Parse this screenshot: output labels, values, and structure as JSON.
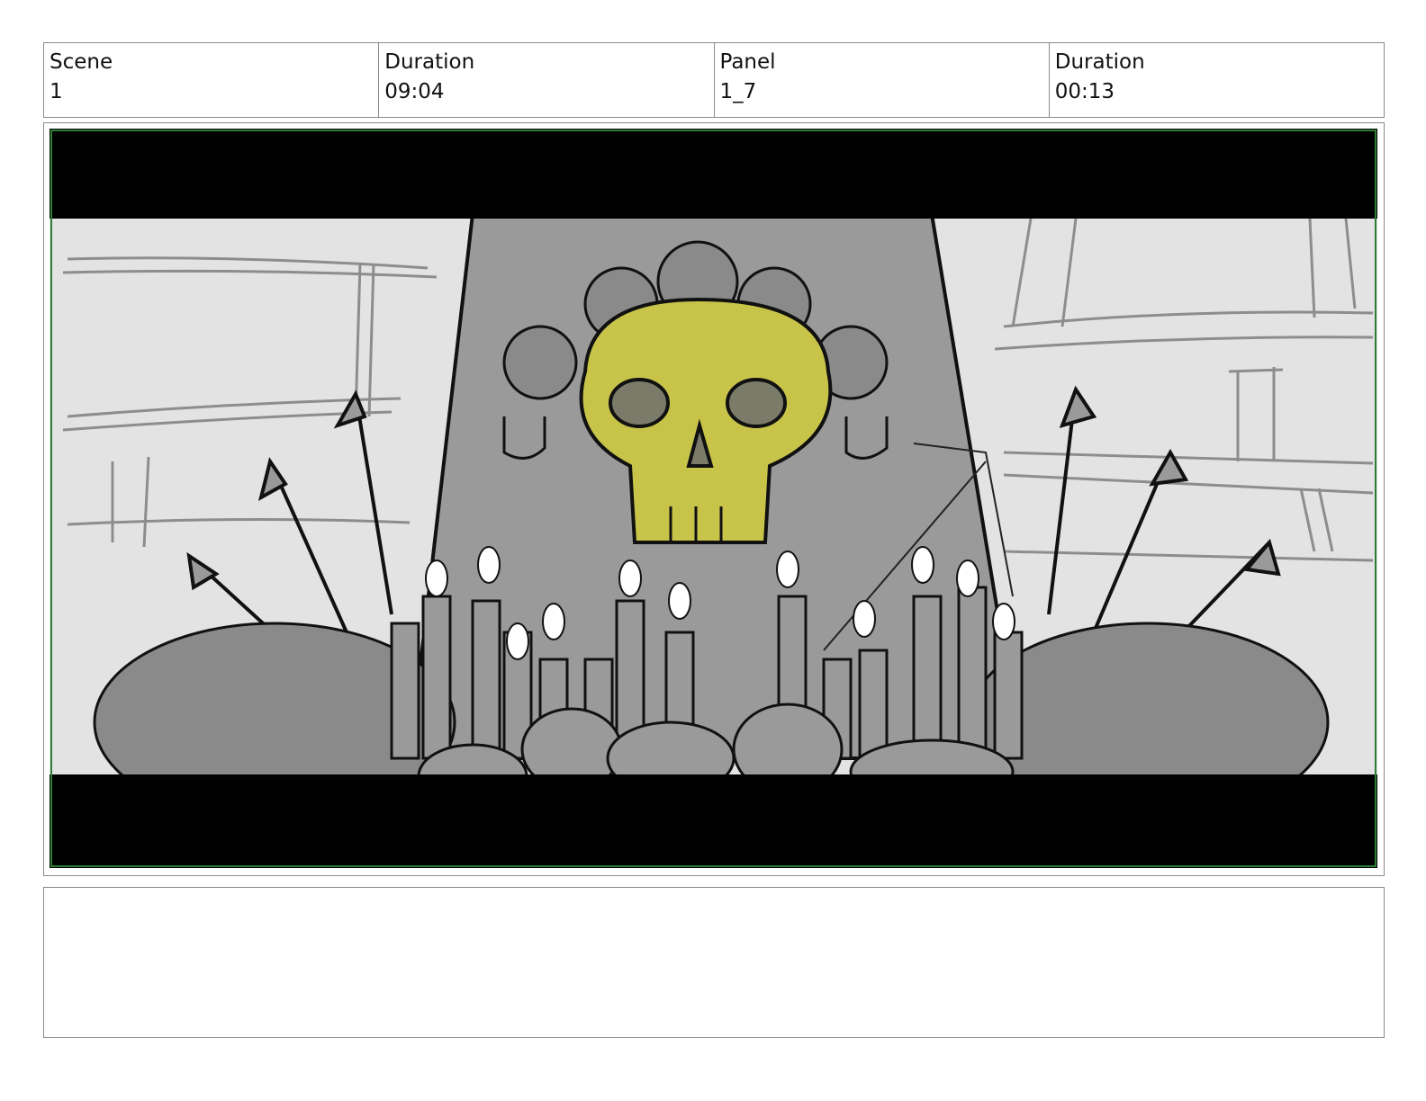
{
  "header": {
    "cells": [
      {
        "label": "Scene",
        "value": "1"
      },
      {
        "label": "Duration",
        "value": "09:04"
      },
      {
        "label": "Panel",
        "value": "1_7"
      },
      {
        "label": "Duration",
        "value": "00:13"
      }
    ]
  },
  "panel": {
    "image_description_icon": "altar-skull-illustration",
    "colors": {
      "letterbox": "#000000",
      "safe_frame": "#2e7d32",
      "background": "#e3e3e3",
      "stone": "#9a9a9a",
      "highlight": "#c8c44a"
    }
  },
  "notes": {
    "text": ""
  }
}
